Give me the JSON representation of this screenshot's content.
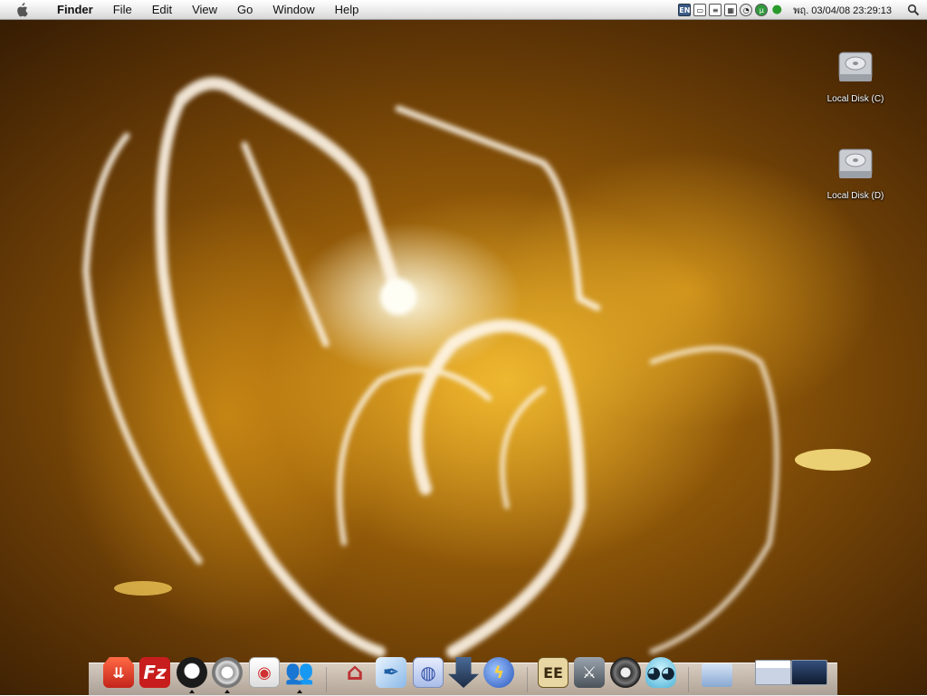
{
  "menubar": {
    "app_name": "Finder",
    "menus": [
      "File",
      "Edit",
      "View",
      "Go",
      "Window",
      "Help"
    ],
    "tray": {
      "input_language": "EN",
      "clock": "พฤ. 03/04/08 23:29:13"
    }
  },
  "desktop_icons": [
    {
      "label": "Local Disk (C)",
      "icon": "hard-disk-icon"
    },
    {
      "label": "Local Disk (D)",
      "icon": "hard-disk-icon"
    }
  ],
  "dock": {
    "items": [
      {
        "icon": "download-manager-icon",
        "color": "#e03a2a"
      },
      {
        "icon": "filezilla-icon",
        "color": "#d42020"
      },
      {
        "icon": "firefox-icon",
        "color": "#1b1b1b",
        "running": true
      },
      {
        "icon": "media-player-icon",
        "color": "#cfcfcf",
        "running": true
      },
      {
        "icon": "preview-eye-icon",
        "color": "#f2f2f2"
      },
      {
        "icon": "messenger-icon",
        "color": "#4aa7d8",
        "running": true
      },
      {
        "icon": "home-pencil-icon",
        "color": "#e9e4dc"
      },
      {
        "icon": "quill-icon",
        "color": "#2c7fc7"
      },
      {
        "icon": "globe-window-icon",
        "color": "#6a8fd8"
      },
      {
        "icon": "download-arrow-icon",
        "color": "#2a3c5a"
      },
      {
        "icon": "globe-flash-icon",
        "color": "#3a6fc8"
      },
      {
        "icon": "game-logo-icon",
        "color": "#d9c28a"
      },
      {
        "icon": "counter-strike-icon",
        "color": "#5a6470"
      },
      {
        "icon": "burnout-disc-icon",
        "color": "#444"
      },
      {
        "icon": "ghost-icon",
        "color": "#7fd3ea"
      },
      {
        "icon": "folder-icon",
        "color": "#a9c3e8"
      },
      {
        "icon": "window-thumbnail-icon",
        "color": "#d8d8d8"
      },
      {
        "icon": "window-thumbnail-icon-2",
        "color": "#1a2a4a"
      }
    ]
  }
}
